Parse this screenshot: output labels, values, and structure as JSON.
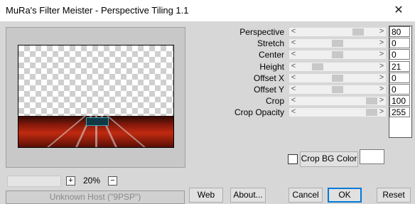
{
  "window": {
    "title": "MuRa's Filter Meister - Perspective Tiling 1.1",
    "close_glyph": "✕"
  },
  "zoom": {
    "plus": "+",
    "minus": "−",
    "value": "20%"
  },
  "status_text": "Unknown Host (\"9PSP\")",
  "buttons": {
    "web": "Web",
    "about": "About...",
    "cancel": "Cancel",
    "ok": "OK",
    "reset": "Reset"
  },
  "crop_bg": {
    "label": "Crop BG Color",
    "checked": false,
    "color": "#ffffff"
  },
  "params": [
    {
      "label": "Perspective",
      "value": "80",
      "level": 0.8
    },
    {
      "label": "Stretch",
      "value": "0",
      "level": 0.5
    },
    {
      "label": "Center",
      "value": "0",
      "level": 0.5
    },
    {
      "label": "Height",
      "value": "21",
      "level": 0.21
    },
    {
      "label": "Offset X",
      "value": "0",
      "level": 0.5
    },
    {
      "label": "Offset Y",
      "value": "0",
      "level": 0.5
    },
    {
      "label": "Crop",
      "value": "100",
      "level": 1.0
    },
    {
      "label": "Crop Opacity",
      "value": "255",
      "level": 1.0
    }
  ],
  "slider_arrows": {
    "left": "<",
    "right": ">"
  },
  "colors": {
    "accent": "#0078d7",
    "floor_red": "#c02a10"
  }
}
